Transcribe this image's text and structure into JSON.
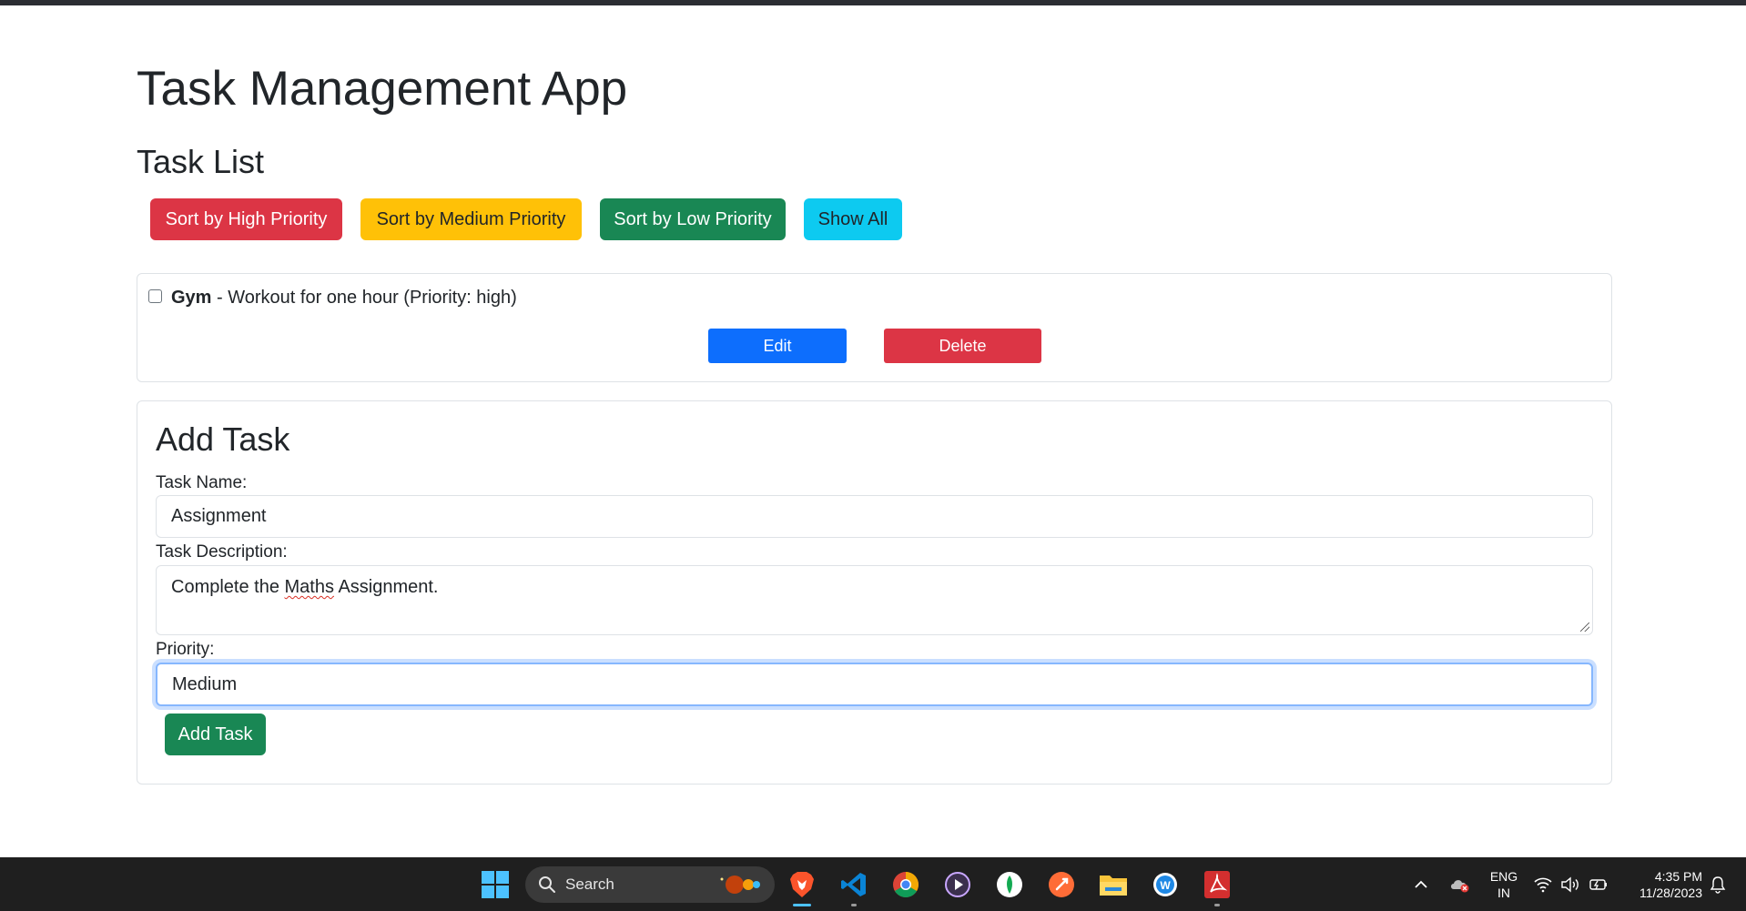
{
  "app": {
    "title": "Task Management App",
    "list_title": "Task List"
  },
  "sort_buttons": {
    "high": "Sort by High Priority",
    "medium": "Sort by Medium Priority",
    "low": "Sort by Low Priority",
    "all": "Show All"
  },
  "tasks": [
    {
      "name": "Gym",
      "detail": " - Workout for one hour (Priority: high)",
      "completed": false,
      "edit_label": "Edit",
      "delete_label": "Delete"
    }
  ],
  "add_form": {
    "title": "Add Task",
    "name_label": "Task Name:",
    "name_value": "Assignment",
    "desc_label": "Task Description:",
    "desc_value_pre": "Complete the ",
    "desc_value_misspelled": "Maths",
    "desc_value_post": " Assignment.",
    "priority_label": "Priority:",
    "priority_value": "Medium",
    "submit_label": "Add Task"
  },
  "colors": {
    "danger": "#dc3545",
    "warning": "#ffc107",
    "success": "#198754",
    "info": "#0dcaf0",
    "primary": "#0d6efd"
  },
  "taskbar": {
    "search_placeholder": "Search",
    "apps": [
      "windows-start-icon",
      "brave-browser-icon",
      "vscode-icon",
      "chrome-icon",
      "media-player-icon",
      "mongodb-compass-icon",
      "postman-icon",
      "file-explorer-icon",
      "word-app-icon",
      "acrobat-icon"
    ],
    "lang_top": "ENG",
    "lang_bottom": "IN",
    "time": "4:35 PM",
    "date": "11/28/2023"
  }
}
